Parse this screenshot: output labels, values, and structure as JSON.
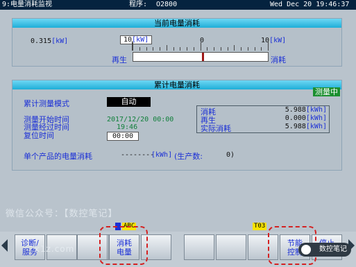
{
  "header": {
    "screen_title": "9:电量消耗监视",
    "program_label": "程序:",
    "program_no": "O2800",
    "datetime": "Wed Dec 20 19:46:37"
  },
  "current_power": {
    "title": "当前电量消耗",
    "value": "0.315",
    "unit": "[kW]",
    "scale_left_value": "10",
    "scale_mid_value": "0",
    "scale_right_value": "10",
    "regen_label": "再生",
    "consume_label": "消耗",
    "needle_level_kw": 0.315
  },
  "cumulative": {
    "title": "累计电量消耗",
    "status_badge": "测量中",
    "mode_label": "累计测量模式",
    "mode_value": "自动",
    "start_time_label": "测量开始时间",
    "start_time_value": "2017/12/20 00:00",
    "elapsed_label": "测量经过时间",
    "elapsed_value": "19:46",
    "reset_label": "复位时间",
    "reset_value": "00:00",
    "summary": [
      {
        "label": "消耗",
        "value": "5.988",
        "unit": "[kWh]"
      },
      {
        "label": "再生",
        "value": "0.000",
        "unit": "[kWh]"
      },
      {
        "label": "实际消耗",
        "value": "5.988",
        "unit": "[kWh]"
      }
    ],
    "per_product_label": "单个产品的电量消耗",
    "per_product_value": "--------",
    "per_product_unit": "[kWh]",
    "per_product_count_label": "(生产数:",
    "per_product_count": "0)"
  },
  "watermark": "微信公众号：【数控笔记】",
  "watermark2": "k1z.com",
  "tags": {
    "mode_tag": "ABC",
    "tool_tag": "T03"
  },
  "softkeys": [
    {
      "label": "诊断/\n服务"
    },
    {
      "label": ""
    },
    {
      "label": ""
    },
    {
      "label": ""
    },
    {
      "label": "消耗\n电量"
    },
    {
      "label": ""
    },
    {
      "label": ""
    },
    {
      "label": ""
    },
    {
      "label": ""
    },
    {
      "label": ""
    },
    {
      "label": "节能\n控制"
    },
    {
      "label": "停止"
    }
  ],
  "logo_text": "数控笔记",
  "colors": {
    "panel_header": "#1eaed8",
    "title_bar": "#05233f",
    "highlight_frame": "#d42121",
    "status_green": "#1b8f2f"
  }
}
